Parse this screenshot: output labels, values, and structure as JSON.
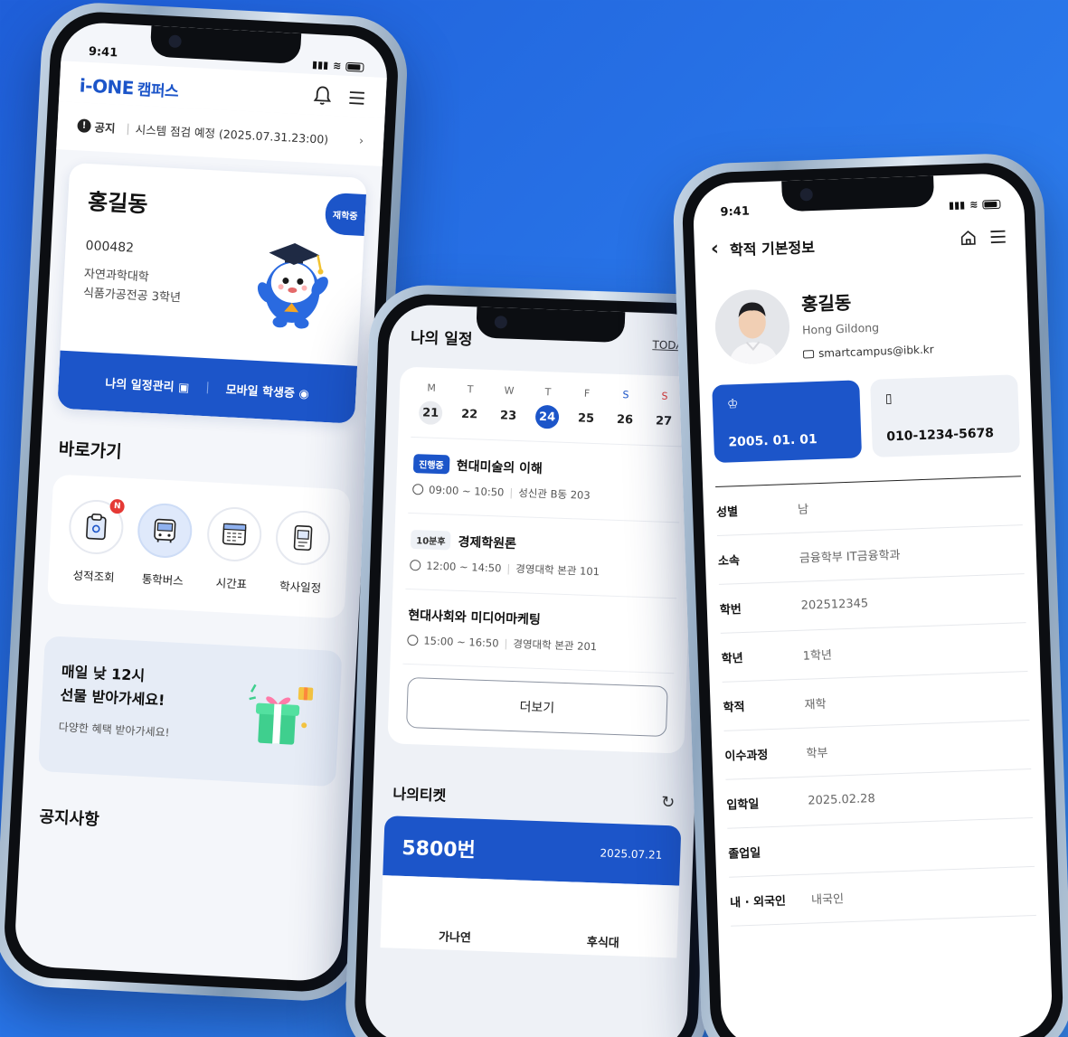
{
  "status_time": "9:41",
  "campus": {
    "logo": "i-ONE",
    "logo_ko": "캠퍼스",
    "notice": {
      "tag": "공지",
      "text": "시스템 점검 예정 (2025.07.31.23:00)"
    },
    "card": {
      "name": "홍길동",
      "student_no": "000482",
      "college": "자연과학대학",
      "major": "식품가공전공 3학년",
      "status": "재학중",
      "schedule_btn": "나의 일정관리",
      "mobile_id_btn": "모바일 학생증"
    },
    "shortcut_title": "바로가기",
    "shortcuts": [
      {
        "label": "성적조회",
        "badge": "N"
      },
      {
        "label": "통학버스",
        "badge": ""
      },
      {
        "label": "시간표",
        "badge": ""
      },
      {
        "label": "학사일정",
        "badge": ""
      }
    ],
    "promo": {
      "line1": "매일 낮 12시",
      "line2": "선물 받아가세요!",
      "sub": "다양한 혜택 받아가세요!"
    },
    "notice_section": "공지사항"
  },
  "schedule": {
    "title": "나의 일정",
    "today": "TODAY",
    "days": [
      {
        "w": "M",
        "d": "21"
      },
      {
        "w": "T",
        "d": "22"
      },
      {
        "w": "W",
        "d": "23"
      },
      {
        "w": "T",
        "d": "24"
      },
      {
        "w": "F",
        "d": "25"
      },
      {
        "w": "S",
        "d": "26"
      },
      {
        "w": "S",
        "d": "27"
      }
    ],
    "events": [
      {
        "tag": "진행중",
        "name": "현대미술의 이해",
        "time": "09:00 ~ 10:50",
        "place": "성신관 B동 203"
      },
      {
        "tag": "10분후",
        "name": "경제학원론",
        "time": "12:00 ~ 14:50",
        "place": "경영대학 본관 101"
      },
      {
        "tag": "",
        "name": "현대사회와 미디어마케팅",
        "time": "15:00 ~ 16:50",
        "place": "경영대학 본관 201"
      }
    ],
    "more": "더보기",
    "ticket_title": "나의티켓",
    "ticket_no": "5800번",
    "ticket_date": "2025.07.21",
    "ticket_col1": "가나연",
    "ticket_col2": "후식대"
  },
  "profile": {
    "title": "학적 기본정보",
    "name": "홍길동",
    "name_en": "Hong Gildong",
    "email": "smartcampus@ibk.kr",
    "birth": "2005. 01. 01",
    "phone": "010-1234-5678",
    "rows": [
      {
        "k": "성별",
        "v": "남"
      },
      {
        "k": "소속",
        "v": "금융학부 IT금융학과"
      },
      {
        "k": "학번",
        "v": "202512345"
      },
      {
        "k": "학년",
        "v": "1학년"
      },
      {
        "k": "학적",
        "v": "재학"
      },
      {
        "k": "이수과정",
        "v": "학부"
      },
      {
        "k": "입학일",
        "v": "2025.02.28"
      },
      {
        "k": "졸업일",
        "v": ""
      },
      {
        "k": "내 · 외국인",
        "v": "내국인"
      }
    ]
  }
}
